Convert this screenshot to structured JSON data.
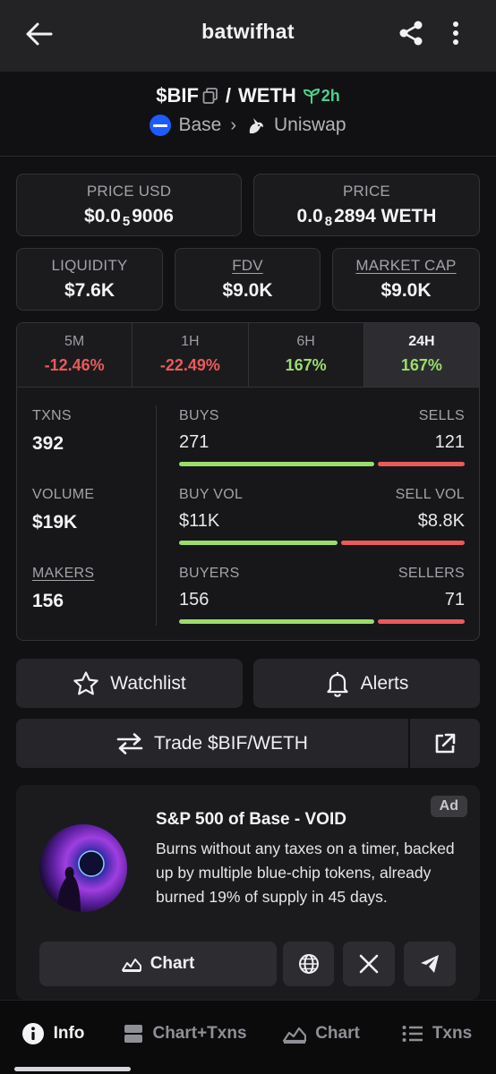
{
  "header": {
    "title": "batwifhat"
  },
  "pair": {
    "base": "$BIF",
    "separator": "/",
    "quote": "WETH",
    "age": "2h",
    "chain": "Base",
    "dex": "Uniswap"
  },
  "price_cards": {
    "price_usd": {
      "label": "PRICE USD",
      "prefix": "$0.0",
      "sub": "5",
      "rest": "9006"
    },
    "price": {
      "label": "PRICE",
      "prefix": "0.0",
      "sub": "8",
      "rest": "2894 WETH"
    }
  },
  "metric_cards": [
    {
      "label": "LIQUIDITY",
      "value": "$7.6K"
    },
    {
      "label": "FDV",
      "value": "$9.0K"
    },
    {
      "label": "MARKET CAP",
      "value": "$9.0K"
    }
  ],
  "timeframes": [
    {
      "label": "5M",
      "change": "-12.46%"
    },
    {
      "label": "1H",
      "change": "-22.49%"
    },
    {
      "label": "6H",
      "change": "167%"
    },
    {
      "label": "24H",
      "change": "167%"
    }
  ],
  "stats": {
    "txns": {
      "label": "TXNS",
      "value": "392",
      "left_label": "BUYS",
      "left_value": "271",
      "right_label": "SELLS",
      "right_value": "121",
      "left_share": 0.69
    },
    "volume": {
      "label": "VOLUME",
      "value": "$19K",
      "left_label": "BUY VOL",
      "left_value": "$11K",
      "right_label": "SELL VOL",
      "right_value": "$8.8K",
      "left_share": 0.56
    },
    "makers": {
      "label": "MAKERS",
      "value": "156",
      "left_label": "BUYERS",
      "left_value": "156",
      "right_label": "SELLERS",
      "right_value": "71",
      "left_share": 0.69
    }
  },
  "actions": {
    "watchlist": "Watchlist",
    "alerts": "Alerts",
    "trade": "Trade $BIF/WETH"
  },
  "ad": {
    "badge": "Ad",
    "title": "S&P 500 of Base - VOID",
    "description": "Burns without any taxes on a timer, backed up by multiple blue-chip tokens, already burned 19% of supply in 45 days.",
    "chart_label": "Chart"
  },
  "nav": [
    {
      "label": "Info",
      "icon": "info-icon"
    },
    {
      "label": "Chart+Txns",
      "icon": "chart-txns-icon"
    },
    {
      "label": "Chart",
      "icon": "chart-icon"
    },
    {
      "label": "Txns",
      "icon": "list-icon"
    }
  ],
  "colors": {
    "positive": "#9bdc6d",
    "negative": "#ea5a5a",
    "age": "#4fd08a",
    "base": "#1b5bff"
  }
}
